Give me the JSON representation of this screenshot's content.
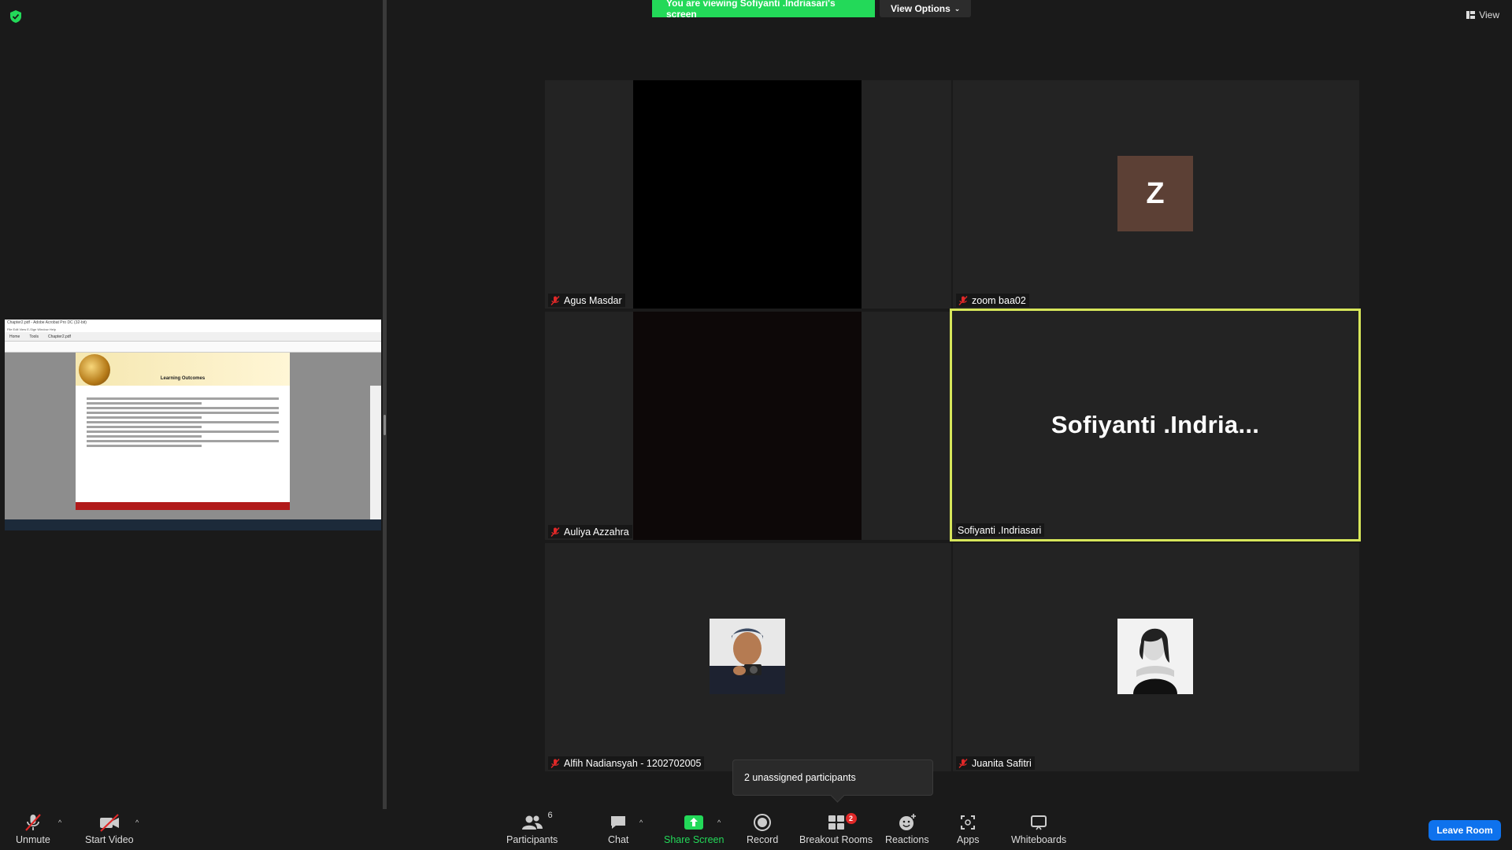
{
  "banner": {
    "viewing_text": "You are viewing Sofiyanti .Indriasari's screen",
    "view_options_label": "View Options"
  },
  "top_right": {
    "view_label": "View"
  },
  "shared_screen": {
    "window_title": "Chapter2.pdf - Adobe Acrobat Pro DC (32-bit)",
    "menu": "File  Edit  View  E-Sign  Window  Help",
    "tabs": [
      "Home",
      "Tools",
      "Chapter2.pdf"
    ],
    "page_title": "Learning Outcomes"
  },
  "tiles": [
    {
      "name": "Agus Masdar",
      "muted": true
    },
    {
      "name": "zoom baa02",
      "muted": true,
      "avatar_letter": "Z"
    },
    {
      "name": "Auliya Azzahra",
      "muted": true
    },
    {
      "name": "Sofiyanti .Indriasari",
      "display_name": "Sofiyanti  .Indria...",
      "muted": false,
      "active_speaker": true
    },
    {
      "name": "Alfih Nadiansyah - 1202702005",
      "muted": true
    },
    {
      "name": "Juanita Safitri",
      "muted": true
    }
  ],
  "tooltip": {
    "text": "2 unassigned participants"
  },
  "toolbar": {
    "unmute": "Unmute",
    "start_video": "Start Video",
    "participants": "Participants",
    "participants_count": "6",
    "chat": "Chat",
    "share_screen": "Share Screen",
    "record": "Record",
    "breakout_rooms": "Breakout Rooms",
    "breakout_badge": "2",
    "reactions": "Reactions",
    "apps": "Apps",
    "whiteboards": "Whiteboards",
    "leave": "Leave Room"
  },
  "colors": {
    "banner_green": "#23d959",
    "active_outline": "#d7e65a",
    "leave_blue": "#0e72ed",
    "badge_red": "#e02828",
    "tile_bg": "#232323"
  }
}
